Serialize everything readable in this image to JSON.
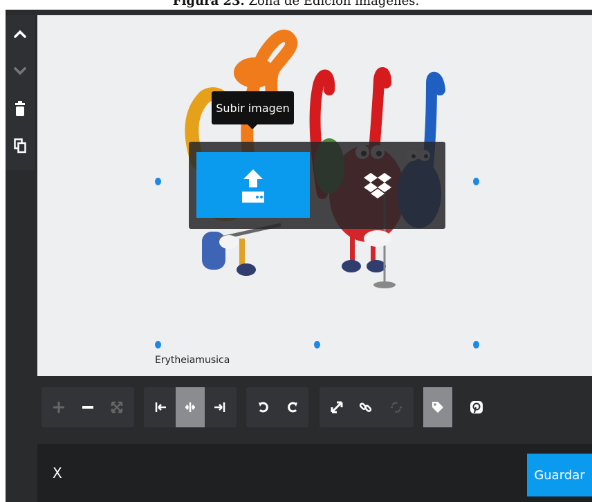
{
  "caption": {
    "bold": "Figura 23.",
    "text": " Zona de Edición imágenes."
  },
  "side_toolbar": {
    "items": [
      "move-up-icon",
      "move-down-icon",
      "trash-icon",
      "copy-icon"
    ]
  },
  "image": {
    "credit": "Erytheiamusica",
    "description_icons": [
      "musical-notes-illustration"
    ]
  },
  "upload": {
    "tooltip": "Subir imagen",
    "sources": [
      "upload-icon",
      "dropbox-icon"
    ]
  },
  "toolbar": {
    "groups": [
      {
        "name": "zoom",
        "buttons": [
          "plus-icon",
          "minus-icon",
          "fit-icon"
        ]
      },
      {
        "name": "align",
        "buttons": [
          "align-left-icon",
          "align-center-icon",
          "align-right-icon"
        ],
        "active": "align-center-icon"
      },
      {
        "name": "rotate",
        "buttons": [
          "rotate-left-icon",
          "rotate-right-icon"
        ]
      },
      {
        "name": "link",
        "buttons": [
          "expand-icon",
          "link-icon",
          "unlink-icon"
        ]
      },
      {
        "name": "meta",
        "buttons": [
          "tag-icon",
          "pinterest-icon"
        ],
        "active": "tag-icon"
      }
    ]
  },
  "footer": {
    "close_label": "X",
    "save_label": "Guardar"
  },
  "colors": {
    "accent": "#0a9bef",
    "handle": "#1e88e5",
    "toolbar_bg": "#2a2b2d"
  }
}
